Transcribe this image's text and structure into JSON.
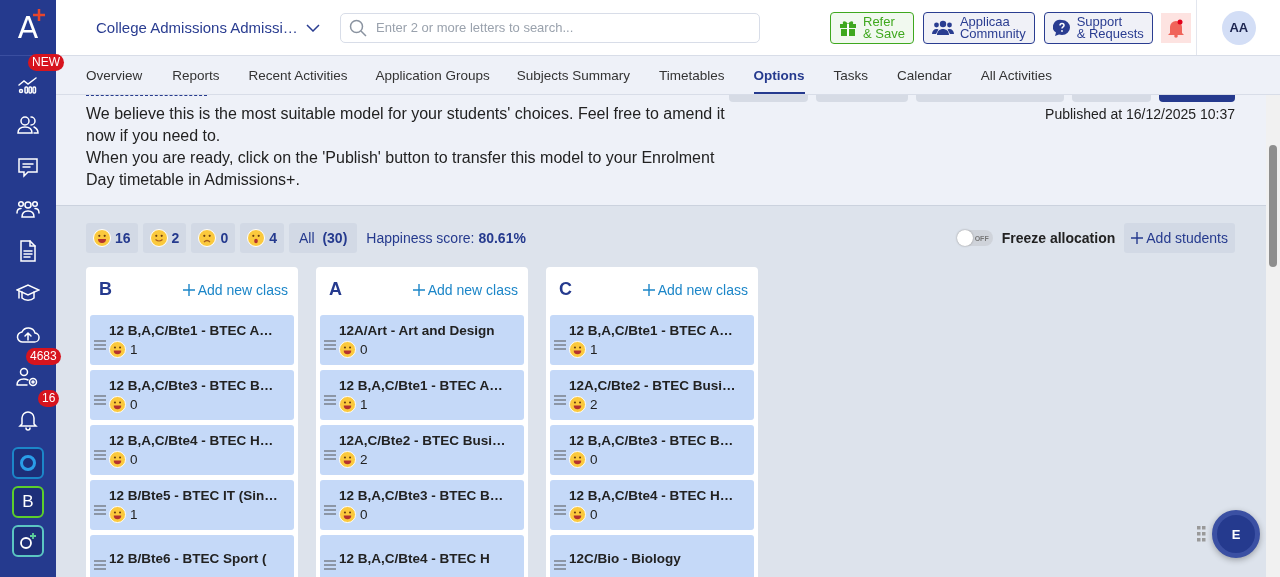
{
  "logo": {
    "letter": "A"
  },
  "sidebar": {
    "items": [
      {
        "kind": "chart",
        "badge": "NEW"
      },
      {
        "kind": "users"
      },
      {
        "kind": "chat"
      },
      {
        "kind": "group"
      },
      {
        "kind": "document"
      },
      {
        "kind": "cap"
      },
      {
        "kind": "upload"
      },
      {
        "kind": "usergear",
        "badge": "4683"
      },
      {
        "kind": "bell",
        "badge": "16"
      }
    ],
    "apps": [
      {
        "kind": "ring"
      },
      {
        "kind": "letter",
        "label": "B"
      },
      {
        "kind": "circleplus"
      }
    ]
  },
  "header": {
    "school": "College Admissions Admissi…",
    "search": {
      "placeholder": "Enter 2 or more letters to search..."
    },
    "buttons": [
      {
        "kind": "gift",
        "line1": "Refer",
        "line2": "& Save",
        "color": "#3fa81e"
      },
      {
        "kind": "community",
        "line1": "Applicaa",
        "line2": "Community",
        "color": "#2a3d91"
      },
      {
        "kind": "support",
        "line1": "Support",
        "line2": "& Requests",
        "color": "#2a3d91"
      }
    ],
    "notification_dot": true,
    "avatar": "AA"
  },
  "tabs": [
    {
      "label": "Overview",
      "selected": false
    },
    {
      "label": "Reports",
      "selected": false
    },
    {
      "label": "Recent Activities",
      "selected": false
    },
    {
      "label": "Application Groups",
      "selected": false
    },
    {
      "label": "Subjects Summary",
      "selected": false
    },
    {
      "label": "Timetables",
      "selected": false
    },
    {
      "label": "Options",
      "selected": true
    },
    {
      "label": "Tasks",
      "selected": false
    },
    {
      "label": "Calendar",
      "selected": false
    },
    {
      "label": "All Activities",
      "selected": false
    }
  ],
  "info": {
    "lines": [
      "We believe this is the most suitable model for your students' choices. Feel free to amend it now if you need to.",
      "When you are ready, click on the 'Publish' button to transfer this model to your Enrolment Day timetable in Admissions+."
    ],
    "published": "Published at 16/12/2025 10:37"
  },
  "filters": [
    {
      "kind": "very_happy",
      "count": "16"
    },
    {
      "kind": "happy",
      "count": "2"
    },
    {
      "kind": "sad",
      "count": "0"
    },
    {
      "kind": "shocked",
      "count": "4"
    }
  ],
  "all": {
    "label": "All",
    "count": "(30)"
  },
  "happiness": {
    "label": "Happiness score:",
    "value": "80.61%"
  },
  "freeze": {
    "label": "Freeze allocation",
    "on": false,
    "state_text": "OFF"
  },
  "add_students": "Add students",
  "columns": [
    {
      "name": "B",
      "add": "Add new class",
      "classes": [
        {
          "title": "12 B,A,C/Bte1 - BTEC A…",
          "kind": "very_happy",
          "count": "1"
        },
        {
          "title": "12 B,A,C/Bte3 - BTEC B…",
          "kind": "very_happy",
          "count": "0"
        },
        {
          "title": "12 B,A,C/Bte4 - BTEC H…",
          "kind": "very_happy",
          "count": "0"
        },
        {
          "title": "12 B/Bte5 - BTEC IT (Sin…",
          "kind": "very_happy",
          "count": "1"
        },
        {
          "title": "12 B/Bte6 - BTEC Sport ("
        }
      ]
    },
    {
      "name": "A",
      "add": "Add new class",
      "classes": [
        {
          "title": "12A/Art - Art and Design",
          "kind": "very_happy",
          "count": "0"
        },
        {
          "title": "12 B,A,C/Bte1 - BTEC A…",
          "kind": "very_happy",
          "count": "1"
        },
        {
          "title": "12A,C/Bte2 - BTEC Busi…",
          "kind": "very_happy",
          "count": "2"
        },
        {
          "title": "12 B,A,C/Bte3 - BTEC B…",
          "kind": "very_happy",
          "count": "0"
        },
        {
          "title": "12 B,A,C/Bte4 - BTEC H"
        }
      ]
    },
    {
      "name": "C",
      "add": "Add new class",
      "classes": [
        {
          "title": "12 B,A,C/Bte1 - BTEC A…",
          "kind": "very_happy",
          "count": "1"
        },
        {
          "title": "12A,C/Bte2 - BTEC Busi…",
          "kind": "very_happy",
          "count": "2"
        },
        {
          "title": "12 B,A,C/Bte3 - BTEC B…",
          "kind": "very_happy",
          "count": "0"
        },
        {
          "title": "12 B,A,C/Bte4 - BTEC H…",
          "kind": "very_happy",
          "count": "0"
        },
        {
          "title": "12C/Bio - Biology"
        }
      ]
    }
  ],
  "chat_button": "E"
}
